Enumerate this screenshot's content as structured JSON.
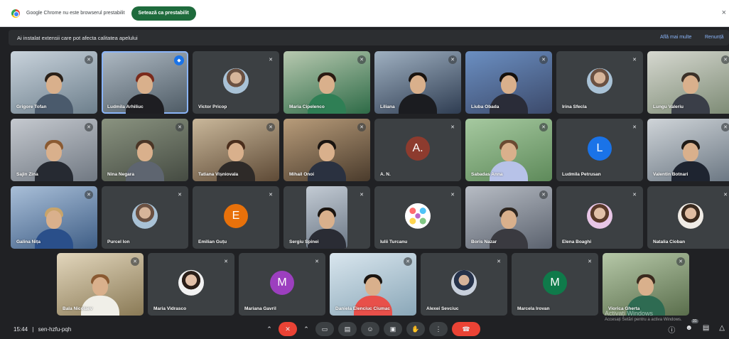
{
  "chrome_infobar": {
    "message": "Google Chrome nu este browserul prestabilit",
    "set_default_label": "Setează ca prestabilit",
    "close_icon": "×"
  },
  "banner": {
    "message": "Ai instalat extensii care pot afecta calitatea apelului",
    "learn_more": "Află mai multe",
    "dismiss": "Renunță"
  },
  "participants": [
    {
      "name": "Grigore Tofan"
    },
    {
      "name": "Ludmila Arhiliuc"
    },
    {
      "name": "Victor Pricop"
    },
    {
      "name": "Maria Cipelenco"
    },
    {
      "name": "Liliana"
    },
    {
      "name": "Liuba Obada"
    },
    {
      "name": "Irina Sfecla"
    },
    {
      "name": "Lungu Valeriu"
    },
    {
      "name": "Sajin Zina"
    },
    {
      "name": "Nina Negara"
    },
    {
      "name": "Tatiana Vișniovala"
    },
    {
      "name": "Mihail Onoi"
    },
    {
      "name": "A. N.",
      "initial": "A."
    },
    {
      "name": "Sabadas Anna"
    },
    {
      "name": "Ludmila Petrusan",
      "initial": "L"
    },
    {
      "name": "Valentin Botnari"
    },
    {
      "name": "Galina Nița"
    },
    {
      "name": "Purcel Ion"
    },
    {
      "name": "Emilian Guțu",
      "initial": "E"
    },
    {
      "name": "Sergiu Spinei"
    },
    {
      "name": "Iulii Turcanu"
    },
    {
      "name": "Boris Nazar"
    },
    {
      "name": "Elena Boaghi"
    },
    {
      "name": "Natalia Cioban"
    },
    {
      "name": "Bala Nicolaev"
    },
    {
      "name": "Maria Vidrasco"
    },
    {
      "name": "Mariana Gavril",
      "initial": "M"
    },
    {
      "name": "Daniela Elenciuc Ciumac"
    },
    {
      "name": "Alexei Sevciuc"
    },
    {
      "name": "Marcela Irovan",
      "initial": "M"
    },
    {
      "name": "Viorica Gherta"
    }
  ],
  "watermark": {
    "title": "Activați Windows",
    "subtitle": "Accesați Setări pentru a activa Windows."
  },
  "bottom_bar": {
    "time": "15:44",
    "separator": "|",
    "meeting_code": "sen-hzfu-pqh",
    "participant_count": "31"
  },
  "icons": {
    "mic_off": "mic-off-icon",
    "camera": "camera-icon",
    "captions": "captions-icon",
    "emoji": "emoji-icon",
    "present": "present-icon",
    "hand": "raise-hand-icon",
    "more": "more-options-icon",
    "leave": "leave-call-icon"
  },
  "colors": {
    "background": "#202124",
    "tile": "#3c4043",
    "accent_green": "#1e6b3c",
    "leave_red": "#ea4335",
    "link_blue": "#8ab4f8"
  }
}
